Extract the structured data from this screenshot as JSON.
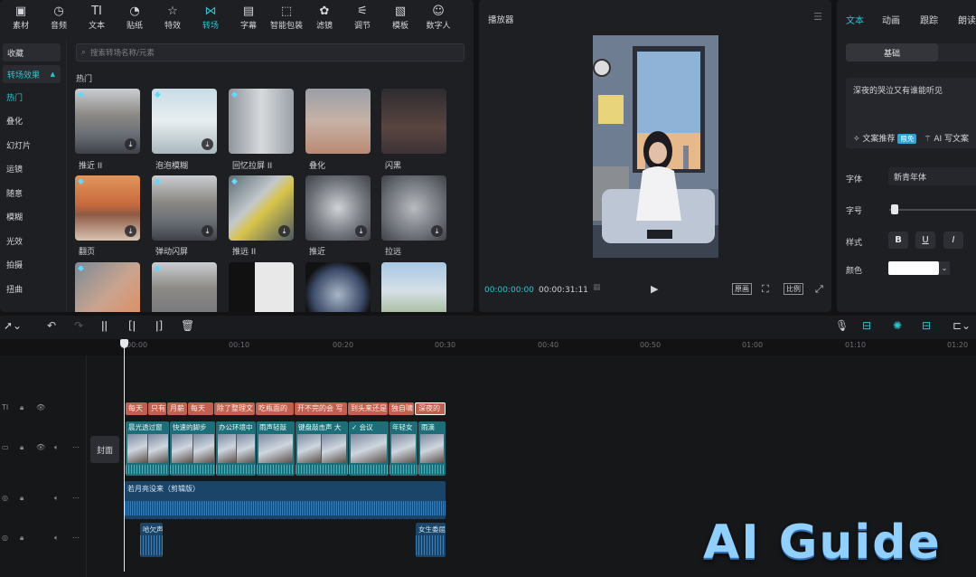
{
  "toolbar": {
    "items": [
      {
        "label": "素材",
        "icon": "media-icon"
      },
      {
        "label": "音频",
        "icon": "audio-icon"
      },
      {
        "label": "文本",
        "icon": "text-icon"
      },
      {
        "label": "贴纸",
        "icon": "sticker-icon"
      },
      {
        "label": "特效",
        "icon": "effects-icon"
      },
      {
        "label": "转场",
        "icon": "transition-icon",
        "active": true
      },
      {
        "label": "字幕",
        "icon": "subtitle-icon"
      },
      {
        "label": "智能包装",
        "icon": "smart-package-icon"
      },
      {
        "label": "滤镜",
        "icon": "filter-icon"
      },
      {
        "label": "调节",
        "icon": "adjust-icon"
      },
      {
        "label": "模板",
        "icon": "template-icon"
      },
      {
        "label": "数字人",
        "icon": "digital-human-icon"
      }
    ]
  },
  "sidebar": {
    "favorites": "收藏",
    "section": "转场效果",
    "items": [
      "热门",
      "叠化",
      "幻灯片",
      "运镜",
      "随意",
      "模糊",
      "光效",
      "拍摄",
      "扭曲"
    ]
  },
  "search": {
    "placeholder": "搜索转场名称/元素"
  },
  "library": {
    "section_title": "热门",
    "cards": [
      {
        "label": "推近 II"
      },
      {
        "label": "泡泡模糊"
      },
      {
        "label": "回忆拉屏 II"
      },
      {
        "label": "叠化"
      },
      {
        "label": "闪黑"
      },
      {
        "label": "翻页"
      },
      {
        "label": "弹动闪屏"
      },
      {
        "label": "推远 II"
      },
      {
        "label": "推近"
      },
      {
        "label": "拉远"
      },
      {
        "label": ""
      },
      {
        "label": ""
      },
      {
        "label": ""
      },
      {
        "label": ""
      },
      {
        "label": ""
      }
    ]
  },
  "player": {
    "title": "播放器",
    "current_time": "00:00:00:00",
    "total_time": "00:00:31:11",
    "buttons": {
      "fullscreen_label": "原画",
      "ratio_label": "比例"
    }
  },
  "props": {
    "tabs": [
      "文本",
      "动画",
      "跟踪",
      "朗读"
    ],
    "sub_tab": "基础",
    "text_value": "深夜的哭泣又有谁能听见",
    "recommend": "文案推荐",
    "free_badge": "限免",
    "ai_write": "AI 写文案",
    "font_label": "字体",
    "font_value": "新青年体",
    "size_label": "字号",
    "style_label": "样式",
    "style_buttons": [
      "B",
      "U",
      "I"
    ],
    "color_label": "颜色",
    "text_color": "#ffffff"
  },
  "timeline": {
    "ruler": [
      "00:00",
      "00:10",
      "00:20",
      "00:30",
      "00:40",
      "00:50",
      "01:00",
      "01:10",
      "01:20"
    ],
    "cover_label": "封面",
    "text_clips": [
      "每天",
      "只有",
      "月薪",
      "每天",
      "除了整理文",
      "吃瓶面的",
      "开不完的会 写",
      "到头来还是",
      "独自啸",
      "深夜的"
    ],
    "video_clips": [
      "晨光透过窗",
      "快速的脚步",
      "办公环境中",
      "雨声轻敲",
      "键盘敲击声 大",
      "会议",
      "年轻女",
      "雨滴"
    ],
    "music_label": "若月亮没来（剪辑版）",
    "sfx_clips": [
      "哈欠声",
      "女生委屈"
    ]
  },
  "watermark": "AI Guide",
  "colors": {
    "accent": "#27c5cf",
    "text_clip": "#c2604f",
    "video_clip": "#1c6f78",
    "audio_clip": "#1a4569"
  }
}
